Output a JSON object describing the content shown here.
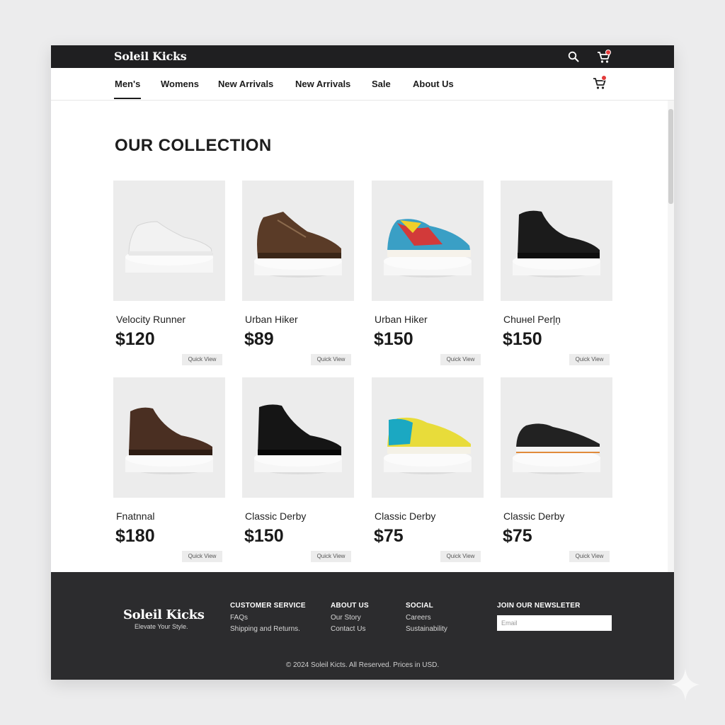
{
  "app": {
    "brand": "Soleil Kicks",
    "cart_badge": "0"
  },
  "nav": {
    "items": [
      {
        "label": "Men's",
        "active": true
      },
      {
        "label": "Womens"
      },
      {
        "label": "New Arrivals"
      },
      {
        "label": "New Arrivals"
      },
      {
        "label": "Sale"
      },
      {
        "label": "About Us"
      }
    ]
  },
  "main": {
    "heading": "OUR COLLECTION",
    "quick_view_label": "Quick View",
    "products": [
      {
        "name": "Velocity Runner",
        "price": "$120",
        "icon": "white-sneaker-icon"
      },
      {
        "name": "Urban Hiker",
        "price": "$89",
        "icon": "brown-hiking-boot-icon"
      },
      {
        "name": "Urban Hiker",
        "price": "$150",
        "icon": "colorful-running-shoe-icon"
      },
      {
        "name": "Chuнel Perļņ",
        "price": "$150",
        "icon": "black-chukka-boot-icon"
      },
      {
        "name": "Fnatnnal",
        "price": "$180",
        "icon": "brown-chukka-boot-icon"
      },
      {
        "name": "Classic Derby",
        "price": "$150",
        "icon": "black-lace-up-boot-icon"
      },
      {
        "name": "Classic Derby",
        "price": "$75",
        "icon": "yellow-teal-sneaker-icon"
      },
      {
        "name": "Classic Derby",
        "price": "$75",
        "icon": "black-knit-sneaker-icon"
      }
    ]
  },
  "footer": {
    "brand": "Soleil Kicks",
    "tagline": "Elevate Your Style.",
    "customer_service": {
      "title": "CUSTOMER SERVICE",
      "links": [
        "FAQs",
        "Shipping and Returns."
      ]
    },
    "about": {
      "title": "ABOUT US",
      "links": [
        "Our Story",
        "Contact Us"
      ]
    },
    "social": {
      "title": "SOCIAL",
      "links": [
        "Careers",
        "Sustainability"
      ]
    },
    "newsletter": {
      "title": "JOIN OUR NEWSLETER",
      "placeholder": "Email"
    },
    "copyright": "© 2024 Soleil Kicts. All Reserved. Prices in USD."
  },
  "colors": {
    "topbar": "#1f1f21",
    "footer": "#2c2c2e",
    "badge": "#e23a3a",
    "card_bg": "#ececec"
  }
}
